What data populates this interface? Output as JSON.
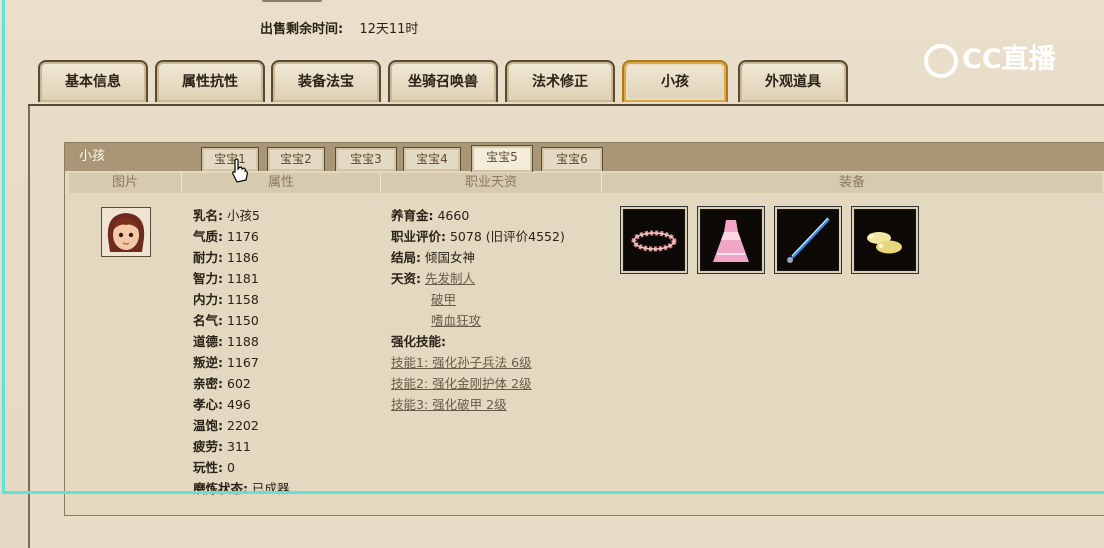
{
  "sale": {
    "label": "出售剩余时间:",
    "value": "12天11时"
  },
  "main_tabs": [
    {
      "label": "基本信息"
    },
    {
      "label": "属性抗性"
    },
    {
      "label": "装备法宝"
    },
    {
      "label": "坐骑召唤兽"
    },
    {
      "label": "法术修正"
    },
    {
      "label": "小孩",
      "active": true
    },
    {
      "label": "外观道具"
    }
  ],
  "kid": {
    "title": "小孩",
    "baby_tabs": [
      {
        "label": "宝宝1"
      },
      {
        "label": "宝宝2"
      },
      {
        "label": "宝宝3"
      },
      {
        "label": "宝宝4"
      },
      {
        "label": "宝宝5",
        "active": true
      },
      {
        "label": "宝宝6"
      }
    ],
    "columns": {
      "picture": "图片",
      "attributes": "属性",
      "career": "职业天资",
      "equipment": "装备"
    },
    "attributes": [
      {
        "k": "乳名:",
        "v": "小孩5"
      },
      {
        "k": "气质:",
        "v": "1176"
      },
      {
        "k": "耐力:",
        "v": "1186"
      },
      {
        "k": "智力:",
        "v": "1181"
      },
      {
        "k": "内力:",
        "v": "1158"
      },
      {
        "k": "名气:",
        "v": "1150"
      },
      {
        "k": "道德:",
        "v": "1188"
      },
      {
        "k": "叛逆:",
        "v": "1167"
      },
      {
        "k": "亲密:",
        "v": "602"
      },
      {
        "k": "孝心:",
        "v": "496"
      },
      {
        "k": "温饱:",
        "v": "2202"
      },
      {
        "k": "疲劳:",
        "v": "311"
      },
      {
        "k": "玩性:",
        "v": "0"
      },
      {
        "k": "磨炼状态:",
        "v": "已成器"
      }
    ],
    "career": {
      "yangyujin_label": "养育金:",
      "yangyujin": "4660",
      "score_label": "职业评价:",
      "score": "5078 (旧评价4552)",
      "ending_label": "结局:",
      "ending": "倾国女神",
      "talent_label": "天资:",
      "talents": [
        "先发制人",
        "破甲",
        "嗜血狂攻"
      ],
      "skills_label": "强化技能:",
      "skills": [
        "技能1: 强化孙子兵法 6级",
        "技能2: 强化金刚护体 2级",
        "技能3: 强化破甲 2级"
      ]
    },
    "equipment_icons": [
      "flower-wreath-icon",
      "pink-dress-icon",
      "blue-sword-icon",
      "golden-shoes-icon"
    ]
  },
  "watermark": "CC直播",
  "colors": {
    "active_tab_border": "#b07a18",
    "header_bg": "#a89676",
    "cyan_frame": "#5fe3d6"
  }
}
